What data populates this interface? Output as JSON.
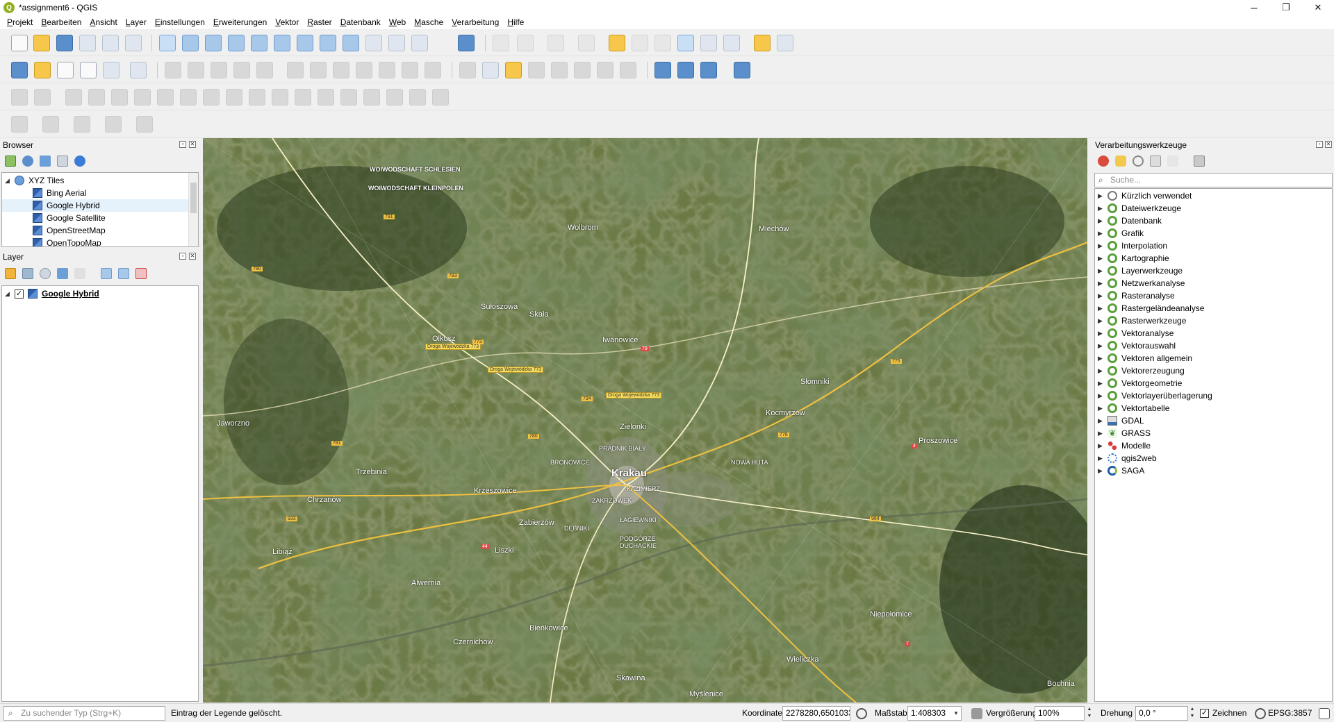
{
  "window": {
    "title": "*assignment6 - QGIS",
    "app_icon": "qgis-icon",
    "controls": {
      "minimize": "─",
      "maximize": "❐",
      "close": "✕"
    }
  },
  "menubar": {
    "items": [
      "Projekt",
      "Bearbeiten",
      "Ansicht",
      "Layer",
      "Einstellungen",
      "Erweiterungen",
      "Vektor",
      "Raster",
      "Datenbank",
      "Web",
      "Masche",
      "Verarbeitung",
      "Hilfe"
    ]
  },
  "browser_panel": {
    "title": "Browser",
    "items": [
      {
        "label": "XYZ Tiles",
        "icon": "xyz-globe-icon",
        "expanded": true
      },
      {
        "label": "Bing Aerial",
        "icon": "xyz-tile-icon"
      },
      {
        "label": "Google Hybrid",
        "icon": "xyz-tile-icon",
        "highlighted": true
      },
      {
        "label": "Google Satellite",
        "icon": "xyz-tile-icon"
      },
      {
        "label": "OpenStreetMap",
        "icon": "xyz-tile-icon"
      },
      {
        "label": "OpenTopoMap",
        "icon": "xyz-tile-icon"
      }
    ]
  },
  "layers_panel": {
    "title": "Layer",
    "items": [
      {
        "label": "Google Hybrid",
        "checked": true,
        "check_glyph": "✓"
      }
    ]
  },
  "processing_panel": {
    "title": "Verarbeitungswerkzeuge",
    "search_placeholder": "Suche...",
    "items": [
      {
        "label": "Kürzlich verwendet",
        "icon": "clock-icon"
      },
      {
        "label": "Dateiwerkzeuge",
        "icon": "qgis-icon"
      },
      {
        "label": "Datenbank",
        "icon": "qgis-icon"
      },
      {
        "label": "Grafik",
        "icon": "qgis-icon"
      },
      {
        "label": "Interpolation",
        "icon": "qgis-icon"
      },
      {
        "label": "Kartographie",
        "icon": "qgis-icon"
      },
      {
        "label": "Layerwerkzeuge",
        "icon": "qgis-icon"
      },
      {
        "label": "Netzwerkanalyse",
        "icon": "qgis-icon"
      },
      {
        "label": "Rasteranalyse",
        "icon": "qgis-icon"
      },
      {
        "label": "Rastergeländeanalyse",
        "icon": "qgis-icon"
      },
      {
        "label": "Rasterwerkzeuge",
        "icon": "qgis-icon"
      },
      {
        "label": "Vektoranalyse",
        "icon": "qgis-icon"
      },
      {
        "label": "Vektorauswahl",
        "icon": "qgis-icon"
      },
      {
        "label": "Vektoren allgemein",
        "icon": "qgis-icon"
      },
      {
        "label": "Vektorerzeugung",
        "icon": "qgis-icon"
      },
      {
        "label": "Vektorgeometrie",
        "icon": "qgis-icon"
      },
      {
        "label": "Vektorlayerüberlagerung",
        "icon": "qgis-icon"
      },
      {
        "label": "Vektortabelle",
        "icon": "qgis-icon"
      },
      {
        "label": "GDAL",
        "icon": "gdal-icon"
      },
      {
        "label": "GRASS",
        "icon": "grass-icon"
      },
      {
        "label": "Modelle",
        "icon": "models-icon"
      },
      {
        "label": "qgis2web",
        "icon": "qgis2web-icon"
      },
      {
        "label": "SAGA",
        "icon": "saga-icon"
      }
    ]
  },
  "map": {
    "place_labels": [
      {
        "text": "Krakau",
        "major": true
      },
      {
        "text": "WOIWODSCHAFT SCHLESIEN"
      },
      {
        "text": "WOIWODSCHAFT KLEINPOLEN"
      },
      {
        "text": "PRĄDNIK BIAŁY"
      },
      {
        "text": "BRONOWICE"
      },
      {
        "text": "ZAKRZÓWEK"
      },
      {
        "text": "KAZIMIERZ"
      },
      {
        "text": "ŁAGIEWNIKI"
      },
      {
        "text": "DĘBNIKI"
      },
      {
        "text": "PODGÓRZE DUCHACKIE"
      },
      {
        "text": "NOWA HUTA"
      },
      {
        "text": "Chrzanów"
      },
      {
        "text": "Jaworzno"
      },
      {
        "text": "Trzebinia"
      },
      {
        "text": "Olkusz"
      },
      {
        "text": "Skawina"
      },
      {
        "text": "Wieliczka"
      },
      {
        "text": "Niepołomice"
      },
      {
        "text": "Miechów"
      },
      {
        "text": "Słomniki"
      },
      {
        "text": "Wolbrom"
      },
      {
        "text": "Proszowice"
      },
      {
        "text": "Bochnia"
      },
      {
        "text": "Krzeszowice"
      },
      {
        "text": "Alwernia"
      },
      {
        "text": "Libiąż"
      },
      {
        "text": "Zabierzów"
      },
      {
        "text": "Zielonki"
      },
      {
        "text": "Kocmyrzów"
      },
      {
        "text": "Iwanowice"
      },
      {
        "text": "Skała"
      },
      {
        "text": "Sułoszowa"
      },
      {
        "text": "Czernichów"
      },
      {
        "text": "Liszki"
      },
      {
        "text": "Myślenice"
      },
      {
        "text": "Bieńkowice"
      }
    ],
    "road_labels": [
      "Droga Wojewódzka 773",
      "Droga Wojewódzka 773",
      "Droga Wojewódzka 773"
    ],
    "road_numbers": [
      "791",
      "790",
      "783",
      "773",
      "794",
      "776",
      "775",
      "780",
      "781",
      "933",
      "964",
      "44",
      "79",
      "7",
      "4"
    ]
  },
  "statusbar": {
    "locator_placeholder": "Zu suchender Typ (Strg+K)",
    "message": "Eintrag der Legende gelöscht.",
    "coordinate_label": "Koordinate",
    "coordinate_value": "2278280,6501033",
    "scale_label": "Maßstab",
    "scale_value": "1:408303",
    "magnifier_label": "Vergrößerung",
    "magnifier_value": "100%",
    "rotation_label": "Drehung",
    "rotation_value": "0,0 °",
    "render_label": "Zeichnen",
    "render_checked": true,
    "crs": "EPSG:3857"
  },
  "colors": {
    "qgis_green": "#93b023",
    "processing_green": "#59a03b",
    "selection": "#cce4f7"
  }
}
